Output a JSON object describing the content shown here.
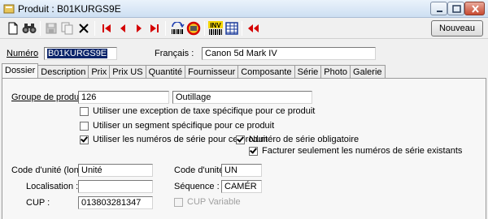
{
  "window": {
    "title": "Produit : B01KURGS9E"
  },
  "toolbar": {
    "icons": [
      "new-document-icon",
      "binoculars-search-icon",
      "save-icon",
      "copy-icon",
      "delete-icon",
      "first-record-icon",
      "previous-record-icon",
      "next-record-icon",
      "last-record-icon",
      "scan-icon",
      "reset-icon",
      "inventory-icon",
      "grid-icon",
      "rewind-icon"
    ],
    "inv_label": "INV",
    "nouveau_label": "Nouveau"
  },
  "header": {
    "numero_label": "Numéro",
    "numero_value": "B01KURGS9E",
    "francais_label": "Français :",
    "francais_value": "Canon 5d Mark IV"
  },
  "tabs": [
    "Dossier",
    "Description",
    "Prix",
    "Prix US",
    "Quantité",
    "Fournisseur",
    "Composante",
    "Série",
    "Photo",
    "Galerie"
  ],
  "active_tab": "Dossier",
  "dossier": {
    "groupe_label": "Groupe de produits :",
    "groupe_code": "126",
    "groupe_name": "Outillage",
    "check_taxe": "Utiliser une exception de taxe spécifique pour ce produit",
    "check_segment": "Utiliser un segment spécifique pour ce produit",
    "check_serie": "Utiliser les numéros de série pour ce produit",
    "check_serie_oblig": "Numéro de série obligatoire",
    "check_facturer": "Facturer seulement les numéros de série existants",
    "code_unite_long_label": "Code d'unité (long) :",
    "code_unite_long_value": "Unité",
    "code_unite_label": "Code d'unité :",
    "code_unite_value": "UN",
    "localisation_label": "Localisation :",
    "localisation_value": "",
    "sequence_label": "Séquence :",
    "sequence_value": "CAMÉR",
    "cup_label": "CUP :",
    "cup_value": "013803281347",
    "cup_variable_label": "CUP Variable"
  }
}
